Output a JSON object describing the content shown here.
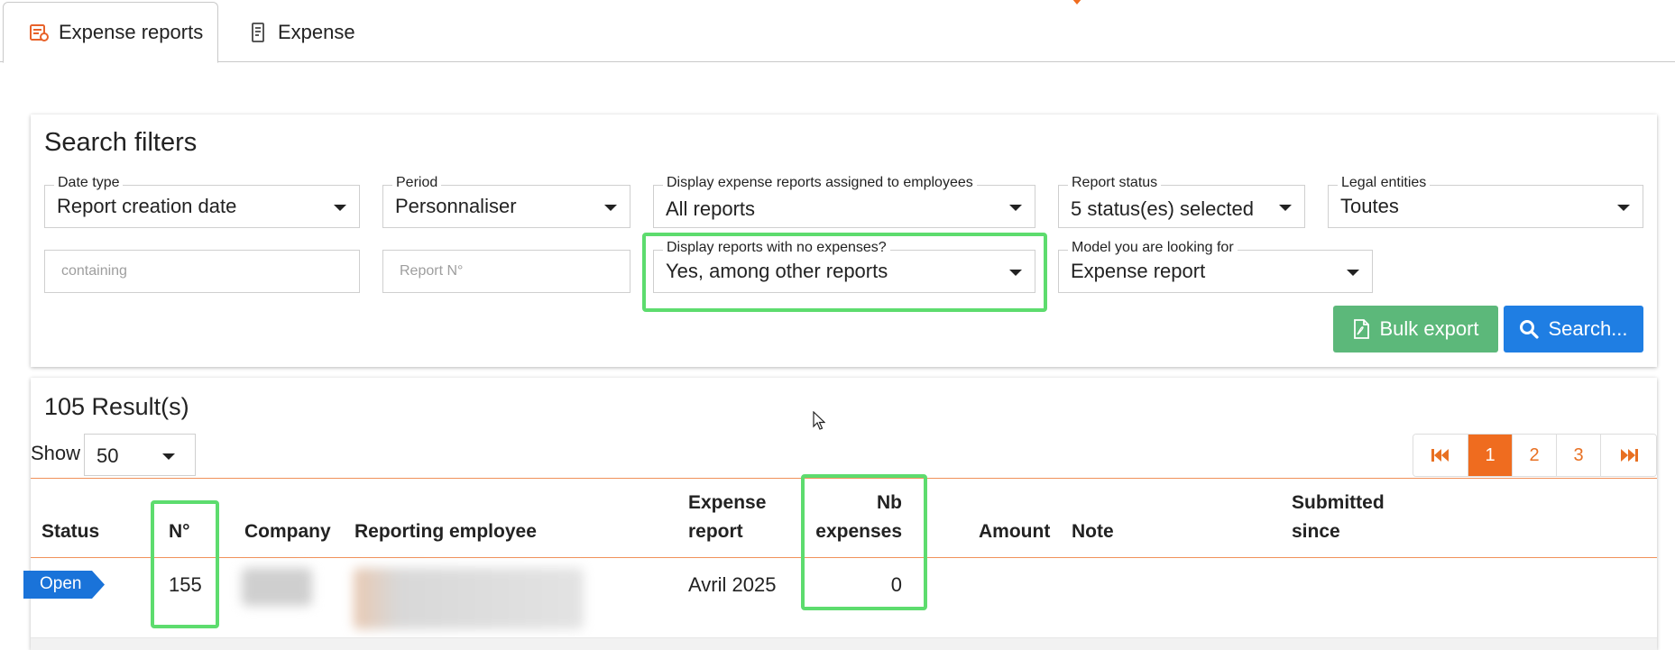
{
  "tabs": [
    {
      "label": "Expense reports",
      "icon": "expense-report-icon",
      "active": true
    },
    {
      "label": "Expense",
      "icon": "receipt-icon",
      "active": false
    }
  ],
  "filters": {
    "title": "Search filters",
    "date_type": {
      "label": "Date type",
      "value": "Report creation date"
    },
    "period": {
      "label": "Period",
      "value": "Personnaliser"
    },
    "assigned": {
      "label": "Display expense reports assigned to employees",
      "value": "All reports"
    },
    "report_status": {
      "label": "Report status",
      "value": "5 status(es) selected"
    },
    "legal_entities": {
      "label": "Legal entities",
      "value": "Toutes"
    },
    "containing": {
      "placeholder": "containing"
    },
    "report_no": {
      "placeholder": "Report N°"
    },
    "no_expenses": {
      "label": "Display reports with no expenses?",
      "value": "Yes, among other reports"
    },
    "model": {
      "label": "Model you are looking for",
      "value": "Expense report"
    },
    "bulk_export_label": "Bulk export",
    "search_label": "Search..."
  },
  "results": {
    "title": "105 Result(s)",
    "show_label": "Show",
    "show_value": "50",
    "pages": [
      "1",
      "2",
      "3"
    ],
    "active_page": "1",
    "columns": {
      "status": "Status",
      "number": "N°",
      "company": "Company",
      "employee": "Reporting employee",
      "report_line1": "Expense",
      "report_line2": "report",
      "nb_line1": "Nb",
      "nb_line2": "expenses",
      "amount": "Amount",
      "note": "Note",
      "submitted_line1": "Submitted",
      "submitted_line2": "since"
    },
    "rows": [
      {
        "status": "Open",
        "number": "155",
        "expense_report": "Avril 2025",
        "nb_expenses": "0"
      }
    ]
  },
  "colors": {
    "accent": "#ef6c1f",
    "highlight": "#5ddc6e",
    "export": "#5cb87a",
    "search": "#1f7ee3",
    "status_open": "#1a73d9"
  }
}
